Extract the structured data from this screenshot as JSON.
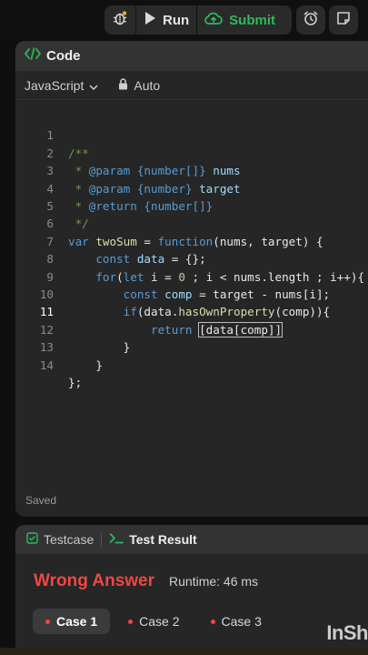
{
  "toolbar": {
    "run_label": "Run",
    "submit_label": "Submit",
    "submit_color": "#2cbb5d"
  },
  "code_panel": {
    "title": "Code",
    "language": "JavaScript",
    "mode": "Auto",
    "status": "Saved"
  },
  "code_lines": [
    {
      "n": "1"
    },
    {
      "n": "2"
    },
    {
      "n": "3"
    },
    {
      "n": "4"
    },
    {
      "n": "5"
    },
    {
      "n": "6"
    },
    {
      "n": "7"
    },
    {
      "n": "8"
    },
    {
      "n": "9"
    },
    {
      "n": "10"
    },
    {
      "n": "11"
    },
    {
      "n": "12"
    },
    {
      "n": "13"
    },
    {
      "n": "14"
    }
  ],
  "code": {
    "l1": "/**",
    "l2_star": " * ",
    "l2_tag": "@param",
    "l2_type": " {number[]}",
    "l2_name": " nums",
    "l3_star": " * ",
    "l3_tag": "@param",
    "l3_type": " {number}",
    "l3_name": " target",
    "l4_star": " * ",
    "l4_tag": "@return",
    "l4_type": " {number[]}",
    "l5": " */",
    "l6_kw": "var",
    "l6_name": " twoSum",
    "l6_eq": " = ",
    "l6_fn": "function",
    "l6_args": "(nums, target) {",
    "l7_kw": "    const",
    "l7_var": " data",
    "l7_rest": " = {};",
    "l8_kw": "    for",
    "l8_a": "(",
    "l8_let": "let",
    "l8_b": " i = ",
    "l8_zero": "0",
    "l8_c": " ; i < nums.length ; i++){",
    "l9_kw": "        const",
    "l9_var": " comp",
    "l9_rest": " = target - nums[i];",
    "l10_kw": "        if",
    "l10_a": "(data.",
    "l10_fn": "hasOwnProperty",
    "l10_b": "(comp)){",
    "l11_kw": "            return",
    "l11_a": " ",
    "l11_box": "[data[comp]]",
    "l12": "        }",
    "l13": "    }",
    "l14": "};"
  },
  "result_panel": {
    "tab_testcase": "Testcase",
    "tab_result": "Test Result",
    "verdict": "Wrong Answer",
    "verdict_color": "#ef4743",
    "runtime": "Runtime: 46 ms",
    "cases": [
      "Case 1",
      "Case 2",
      "Case 3"
    ]
  },
  "watermark": "InSh"
}
